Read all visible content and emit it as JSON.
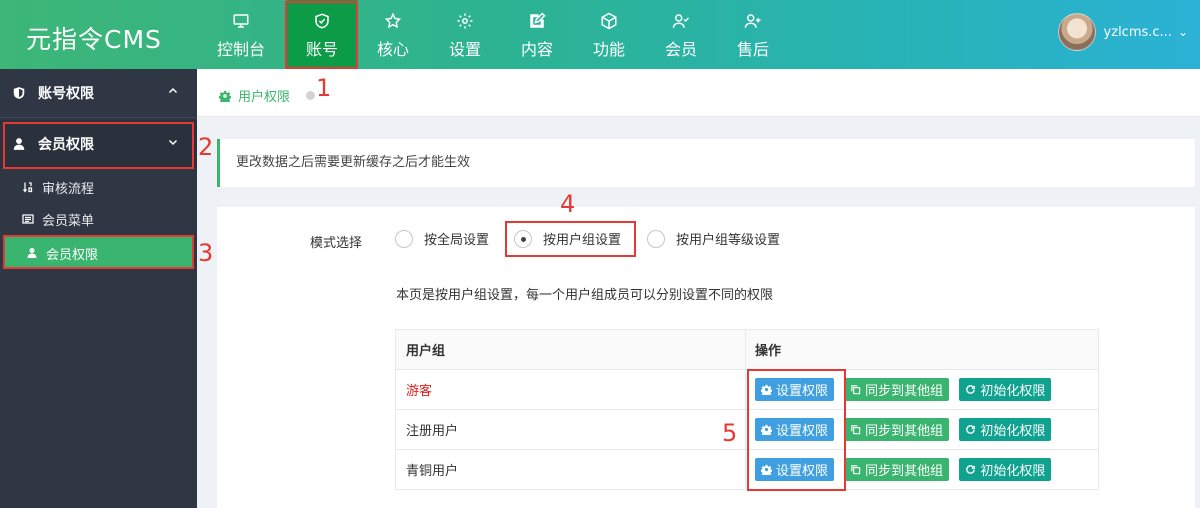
{
  "header": {
    "logo": "元指令CMS",
    "nav": [
      {
        "label": "控制台",
        "icon": "monitor-icon"
      },
      {
        "label": "账号",
        "icon": "shield-icon"
      },
      {
        "label": "核心",
        "icon": "star-icon"
      },
      {
        "label": "设置",
        "icon": "gear-icon"
      },
      {
        "label": "内容",
        "icon": "edit-icon"
      },
      {
        "label": "功能",
        "icon": "cube-icon"
      },
      {
        "label": "会员",
        "icon": "user-check-icon"
      },
      {
        "label": "售后",
        "icon": "user-plus-icon"
      }
    ],
    "active_nav": "账号",
    "user": {
      "name": "yzlcms.c...",
      "caret": "⌄"
    }
  },
  "sidebar": {
    "groups": [
      {
        "label": "账号权限",
        "icon": "shield-icon",
        "expanded": false
      },
      {
        "label": "会员权限",
        "icon": "user-icon",
        "expanded": true
      }
    ],
    "items": [
      {
        "label": "审核流程",
        "icon": "sort-icon"
      },
      {
        "label": "会员菜单",
        "icon": "list-icon"
      },
      {
        "label": "会员权限",
        "icon": "user-icon",
        "active": true
      }
    ]
  },
  "breadcrumb": {
    "label": "用户权限"
  },
  "notice": "更改数据之后需要更新缓存之后才能生效",
  "mode": {
    "label": "模式选择",
    "options": [
      "按全局设置",
      "按用户组设置",
      "按用户组等级设置"
    ],
    "selected": "按用户组设置"
  },
  "description": "本页是按用户组设置，每一个用户组成员可以分别设置不同的权限",
  "table": {
    "headers": [
      "用户组",
      "操作"
    ],
    "rows": [
      {
        "group": "游客",
        "highlight": true
      },
      {
        "group": "注册用户"
      },
      {
        "group": "青铜用户"
      }
    ],
    "actions": [
      "设置权限",
      "同步到其他组",
      "初始化权限"
    ]
  },
  "annotations": [
    "1",
    "2",
    "3",
    "4",
    "5"
  ],
  "colors": {
    "accent": "#3ab56f",
    "sidebar_bg": "#2f3745",
    "annotation": "#e53935",
    "btn_blue": "#3f9fe0",
    "btn_teal": "#0fa28f"
  }
}
